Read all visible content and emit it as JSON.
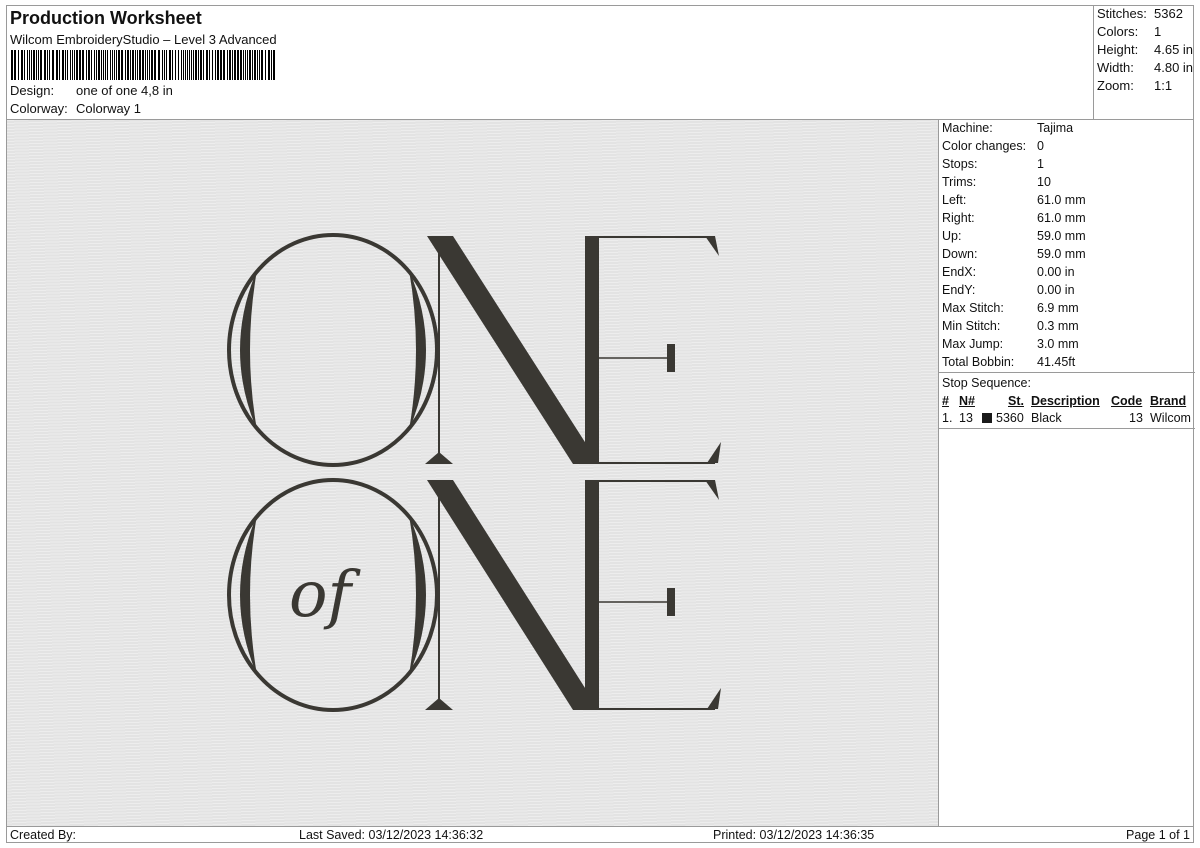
{
  "header": {
    "title": "Production Worksheet",
    "subtitle": "Wilcom EmbroideryStudio – Level 3 Advanced",
    "design_label": "Design:",
    "design_value": "one of one 4,8 in",
    "colorway_label": "Colorway:",
    "colorway_value": "Colorway 1"
  },
  "summary": [
    {
      "label": "Stitches:",
      "value": "5362"
    },
    {
      "label": "Colors:",
      "value": "1"
    },
    {
      "label": "Height:",
      "value": "4.65 in"
    },
    {
      "label": "Width:",
      "value": "4.80 in"
    },
    {
      "label": "Zoom:",
      "value": "1:1"
    }
  ],
  "machine_info": [
    {
      "label": "Machine:",
      "value": "Tajima"
    },
    {
      "label": "Color changes:",
      "value": "0"
    },
    {
      "label": "Stops:",
      "value": "1"
    },
    {
      "label": "Trims:",
      "value": "10"
    },
    {
      "label": "Left:",
      "value": "61.0 mm"
    },
    {
      "label": "Right:",
      "value": "61.0 mm"
    },
    {
      "label": "Up:",
      "value": "59.0 mm"
    },
    {
      "label": "Down:",
      "value": "59.0 mm"
    },
    {
      "label": "EndX:",
      "value": "0.00 in"
    },
    {
      "label": "EndY:",
      "value": "0.00 in"
    },
    {
      "label": "Max Stitch:",
      "value": "6.9 mm"
    },
    {
      "label": "Min Stitch:",
      "value": "0.3 mm"
    },
    {
      "label": "Max Jump:",
      "value": "3.0 mm"
    },
    {
      "label": "Total Bobbin:",
      "value": "41.45ft"
    }
  ],
  "stop_sequence": {
    "title": "Stop Sequence:",
    "columns": [
      "#",
      "N#",
      "St.",
      "Description",
      "Code",
      "Brand"
    ],
    "rows": [
      {
        "index": "1.",
        "n": "13",
        "stitches": "5360",
        "description": "Black",
        "code": "13",
        "brand": "Wilcom",
        "color": "#1a1a1a"
      }
    ]
  },
  "design": {
    "line1": "ONE",
    "line2_left": "of",
    "line2": "ONE",
    "thread_color": "#3a3833",
    "fabric_color": "#e3e3e3"
  },
  "footer": {
    "created_by": "Created By:",
    "last_saved": "Last Saved: 03/12/2023 14:36:32",
    "printed": "Printed: 03/12/2023 14:36:35",
    "page": "Page 1 of 1"
  }
}
